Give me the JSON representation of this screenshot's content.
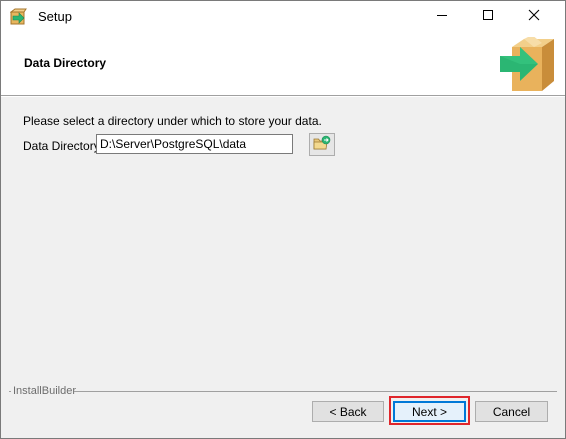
{
  "window": {
    "title": "Setup",
    "app_icon": "setup-package-icon",
    "controls": {
      "minimize_icon": "minimize-icon",
      "maximize_icon": "maximize-icon",
      "close_icon": "close-icon"
    }
  },
  "header": {
    "title": "Data Directory",
    "logo_icon": "package-arrow-logo-icon"
  },
  "content": {
    "instruction": "Please select a directory under which to store your data.",
    "field_label": "Data Directory",
    "field_value": "D:\\Server\\PostgreSQL\\data",
    "browse_icon": "browse-folder-icon"
  },
  "footer": {
    "brand": "InstallBuilder",
    "back_label": "< Back",
    "next_label": "Next >",
    "cancel_label": "Cancel"
  },
  "colors": {
    "highlight": "#e0262b",
    "focus": "#0078d7",
    "logo_green": "#2bb673",
    "logo_box": "#e9b25c"
  }
}
